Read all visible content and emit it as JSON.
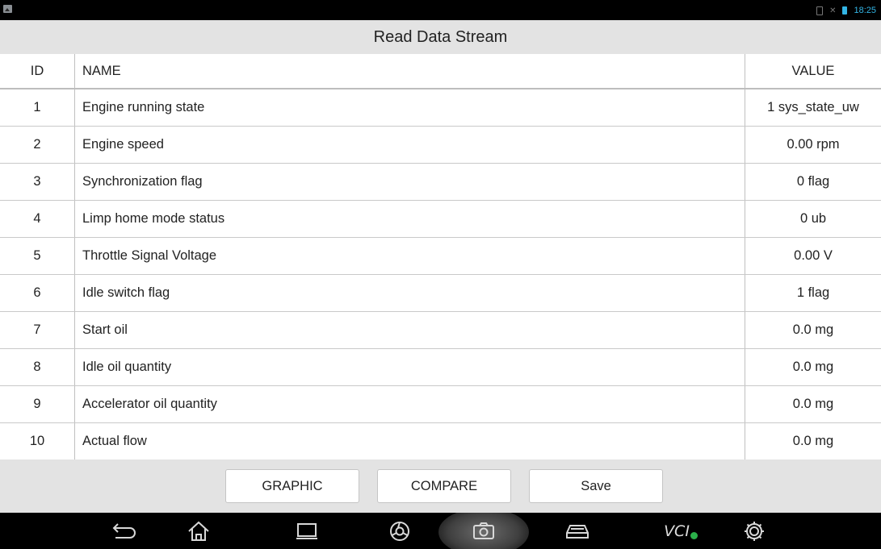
{
  "status_bar": {
    "time": "18:25"
  },
  "title": "Read Data Stream",
  "table": {
    "headers": {
      "id": "ID",
      "name": "NAME",
      "value": "VALUE"
    },
    "rows": [
      {
        "id": "1",
        "name": "Engine running state",
        "value": "1 sys_state_uw"
      },
      {
        "id": "2",
        "name": "Engine speed",
        "value": "0.00 rpm"
      },
      {
        "id": "3",
        "name": "Synchronization flag",
        "value": "0 flag"
      },
      {
        "id": "4",
        "name": "Limp home mode status",
        "value": "0 ub"
      },
      {
        "id": "5",
        "name": "Throttle Signal Voltage",
        "value": "0.00 V"
      },
      {
        "id": "6",
        "name": "Idle switch flag",
        "value": "1 flag"
      },
      {
        "id": "7",
        "name": "Start oil",
        "value": "0.0 mg"
      },
      {
        "id": "8",
        "name": "Idle oil quantity",
        "value": "0.0 mg"
      },
      {
        "id": "9",
        "name": "Accelerator oil quantity",
        "value": "0.0 mg"
      },
      {
        "id": "10",
        "name": "Actual flow",
        "value": "0.0 mg"
      }
    ]
  },
  "buttons": {
    "graphic": "GRAPHIC",
    "compare": "COMPARE",
    "save": "Save"
  },
  "nav": {
    "vci_label": "VCI"
  },
  "icons": [
    "image-icon",
    "sim-icon",
    "mute-icon",
    "battery-icon",
    "back-icon",
    "home-icon",
    "recent-apps-icon",
    "browser-icon",
    "camera-icon",
    "car-icon",
    "vci-icon",
    "settings-icon"
  ],
  "colors": {
    "accent": "#33b5e5",
    "vci_status": "#2bb04a"
  }
}
